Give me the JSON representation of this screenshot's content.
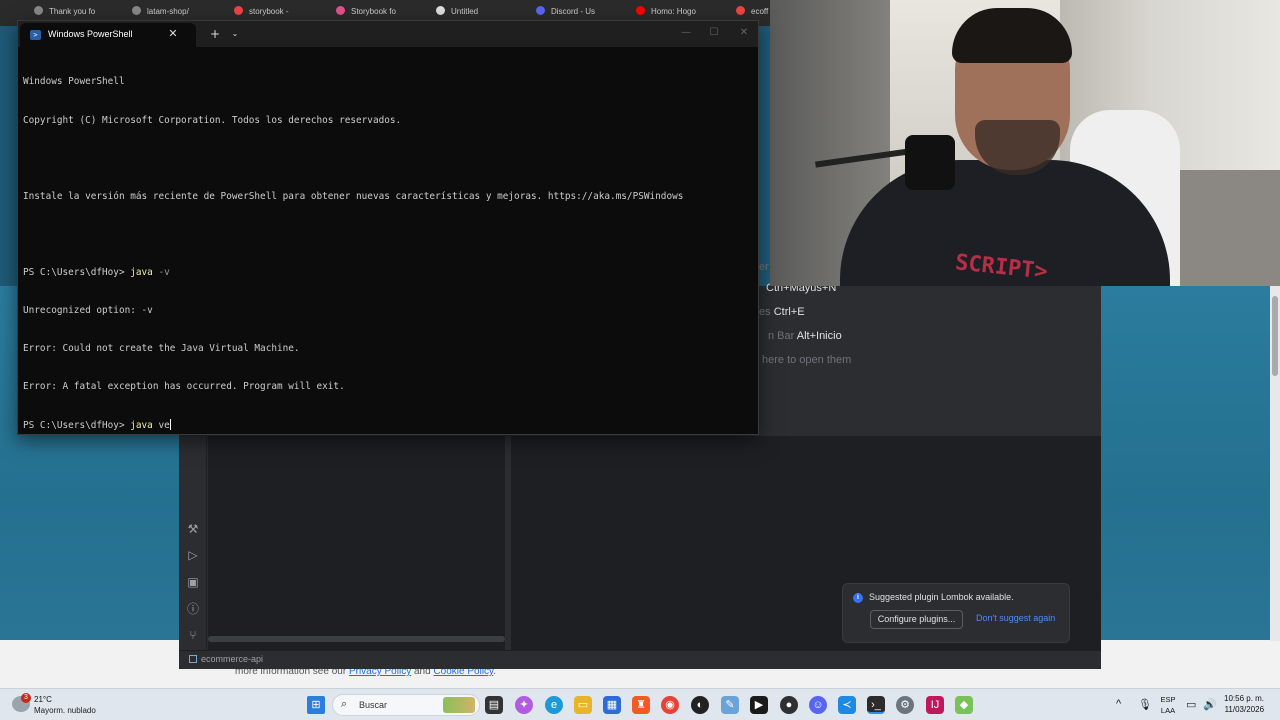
{
  "browser_tabs": [
    {
      "label": "Thank you fo",
      "color": "#888"
    },
    {
      "label": "latam-shop/",
      "color": "#888"
    },
    {
      "label": "storybook - ",
      "color": "#e44"
    },
    {
      "label": "Storybook fo",
      "color": "#e4508f"
    },
    {
      "label": "Untitled",
      "color": "#ddd"
    },
    {
      "label": "Discord - Us",
      "color": "#5865f2"
    },
    {
      "label": "Homo: Hogo",
      "color": "#f00"
    },
    {
      "label": "ecoff",
      "color": "#e44"
    }
  ],
  "terminal": {
    "tab_title": "Windows PowerShell",
    "close_glyph": "✕",
    "new_tab_glyph": "+",
    "dropdown_glyph": "⌄",
    "minimize_glyph": "—",
    "maximize_glyph": "☐",
    "window_close_glyph": "✕",
    "lines": [
      {
        "text": "Windows PowerShell"
      },
      {
        "text": "Copyright (C) Microsoft Corporation. Todos los derechos reservados."
      },
      {
        "text": ""
      },
      {
        "text": "Instale la versión más reciente de PowerShell para obtener nuevas características y mejoras. https://aka.ms/PSWindows"
      },
      {
        "text": ""
      },
      {
        "prompt": "PS C:\\Users\\dfHoy> ",
        "cmd": "java",
        "arg": " -v"
      },
      {
        "text": "Unrecognized option: -v"
      },
      {
        "text": "Error: Could not create the Java Virtual Machine."
      },
      {
        "text": "Error: A fatal exception has occurred. Program will exit."
      },
      {
        "prompt": "PS C:\\Users\\dfHoy> ",
        "cmd": "java",
        "arg": " ve",
        "cursor": true
      }
    ]
  },
  "ide": {
    "welcome": [
      {
        "dim": "er",
        "key": ""
      },
      {
        "dim": "",
        "key": "Ctrl+Mayus+N"
      },
      {
        "dim": "es",
        "key": "Ctrl+E"
      },
      {
        "dim": "n Bar",
        "key": "Alt+Inicio"
      },
      {
        "dim": "here to open them",
        "key": ""
      }
    ],
    "project_name": "ecommerce-api",
    "notification": {
      "message": "Suggested plugin Lombok available.",
      "button": "Configure plugins...",
      "link": "Don't suggest again"
    },
    "tool_icons": [
      "build-icon",
      "run-icon",
      "terminal-icon",
      "problems-icon",
      "git-icon"
    ]
  },
  "website": {
    "footer_prefix": "more information see our ",
    "privacy_link": "Privacy Policy",
    "and_text": " and ",
    "cookie_link": "Cookie Policy",
    "period": "."
  },
  "webcam": {
    "shirt_text": "SCRIPT>"
  },
  "taskbar": {
    "weather": {
      "temp": "21°C",
      "condition": "Mayorm. nublado",
      "badge": "3"
    },
    "search_placeholder": "Buscar",
    "language": "ESP",
    "layout": "LAA",
    "time": "10:56 p. m.",
    "date": "11/03/2026",
    "tray_chevron": "^",
    "apps": [
      {
        "name": "windows-start-icon",
        "color": "#2a7de1"
      },
      {
        "name": "task-view-icon",
        "color": "#333"
      },
      {
        "name": "copilot-icon",
        "color": "#b35be0"
      },
      {
        "name": "edge-icon",
        "color": "#1c9ad6"
      },
      {
        "name": "file-explorer-icon",
        "color": "#e8b52a"
      },
      {
        "name": "store-icon",
        "color": "#2d6bd6"
      },
      {
        "name": "brave-icon",
        "color": "#f15a24"
      },
      {
        "name": "chrome-icon",
        "color": "#e94235"
      },
      {
        "name": "github-icon",
        "color": "#222"
      },
      {
        "name": "notepad-icon",
        "color": "#6aa3d8"
      },
      {
        "name": "pycharm-icon",
        "color": "#1a1a1a"
      },
      {
        "name": "obs-icon",
        "color": "#303030"
      },
      {
        "name": "discord-icon",
        "color": "#5865f2"
      },
      {
        "name": "vscode-icon",
        "color": "#1e88e5"
      },
      {
        "name": "terminal-icon",
        "color": "#2b2b2b"
      },
      {
        "name": "settings-icon",
        "color": "#6b7580"
      },
      {
        "name": "intellij-icon",
        "color": "#c2185b"
      },
      {
        "name": "android-icon",
        "color": "#78c257"
      }
    ]
  }
}
